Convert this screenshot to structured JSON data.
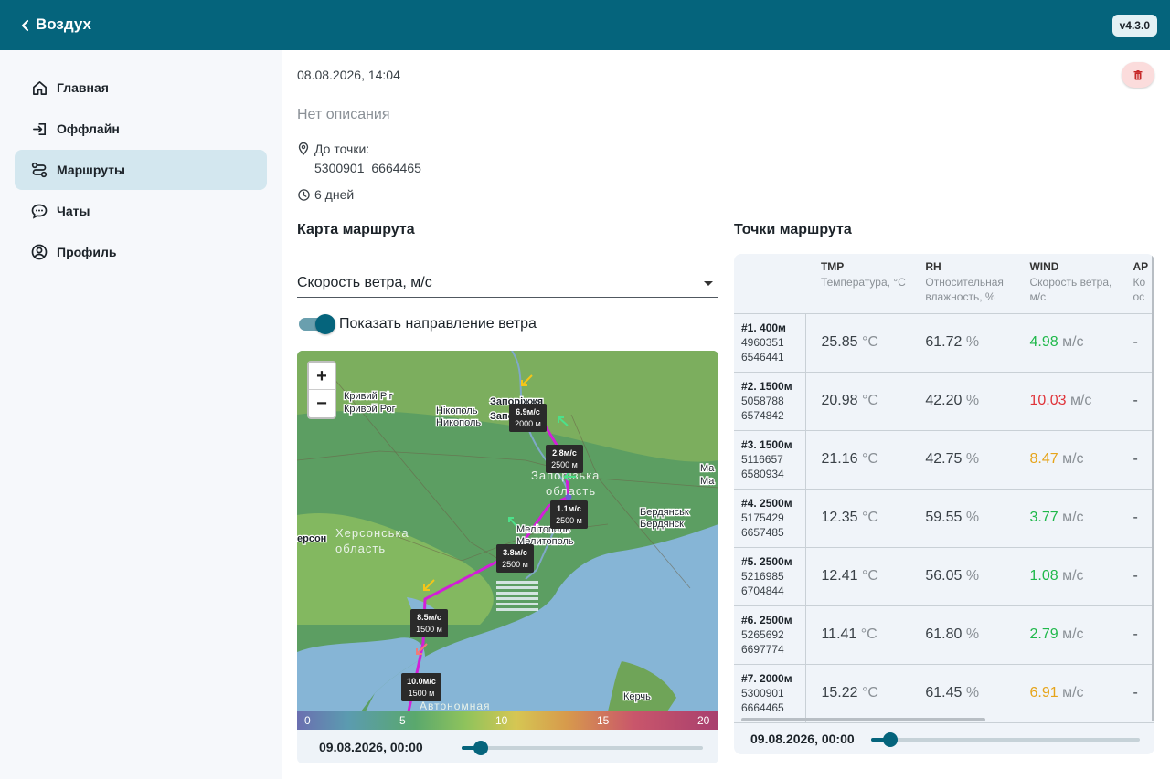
{
  "appbar": {
    "title": "Воздух",
    "version": "v4.3.0"
  },
  "sidebar": {
    "items": [
      {
        "label": "Главная",
        "icon": "home-icon"
      },
      {
        "label": "Оффлайн",
        "icon": "login-icon"
      },
      {
        "label": "Маршруты",
        "icon": "route-icon",
        "active": true
      },
      {
        "label": "Чаты",
        "icon": "chat-icon"
      },
      {
        "label": "Профиль",
        "icon": "account-icon"
      }
    ]
  },
  "route": {
    "date": "08.08.2026, 14:04",
    "description": "Нет описания",
    "to_point_label": "До точки:",
    "to_point_coords": "5300901 6664465",
    "duration": "6 дней"
  },
  "map_section": {
    "title": "Карта маршрута",
    "layer_select": "Скорость ветра, м/с",
    "toggle_label": "Показать направление ветра",
    "toggle_on": true,
    "zoom_in": "+",
    "zoom_out": "−",
    "place_labels": [
      "Кривий Ріг",
      "Кривой Рог",
      "Нікополь",
      "Никополь",
      "Запоріжжя",
      "Запорожье",
      "Запорізька",
      "область",
      "Бердянськ",
      "Бердянск",
      "Мелітополь",
      "Мелитополь",
      "Херсонська",
      "область",
      "ерсон",
      "Автономная",
      "Керчь",
      "Ма",
      "Ма"
    ],
    "markers": [
      {
        "speed": "6.9м/с",
        "alt": "2000 м"
      },
      {
        "speed": "2.8м/с",
        "alt": "2500 м"
      },
      {
        "speed": "1.1м/с",
        "alt": "2500 м"
      },
      {
        "speed": "3.8м/с",
        "alt": "2500 м"
      },
      {
        "speed": "8.5м/с",
        "alt": "1500 м"
      },
      {
        "speed": "10.0м/с",
        "alt": "1500 м"
      }
    ],
    "legend": [
      "0",
      "5",
      "10",
      "15",
      "20"
    ],
    "time": "09.08.2026, 00:00",
    "time_slider_fraction": 0.08
  },
  "points_section": {
    "title": "Точки маршрута",
    "columns": [
      {
        "code": "TMP",
        "desc": "Температура, °C"
      },
      {
        "code": "RH",
        "desc": "Относительная влажность, %"
      },
      {
        "code": "WIND",
        "desc": "Скорость ветра, м/с"
      },
      {
        "code": "AP",
        "desc": "Ко ос"
      }
    ],
    "rows": [
      {
        "title": "#1. 400м",
        "c1": "4960351",
        "c2": "6546441",
        "tmp": "25.85",
        "rh": "61.72",
        "wind": "4.98",
        "wind_color": "#1fb84a",
        "ap": "-"
      },
      {
        "title": "#2. 1500м",
        "c1": "5058788",
        "c2": "6574842",
        "tmp": "20.98",
        "rh": "42.20",
        "wind": "10.03",
        "wind_color": "#e0343a",
        "ap": "-"
      },
      {
        "title": "#3. 1500м",
        "c1": "5116657",
        "c2": "6580934",
        "tmp": "21.16",
        "rh": "42.75",
        "wind": "8.47",
        "wind_color": "#e6a41a",
        "ap": "-"
      },
      {
        "title": "#4. 2500м",
        "c1": "5175429",
        "c2": "6657485",
        "tmp": "12.35",
        "rh": "59.55",
        "wind": "3.77",
        "wind_color": "#1fb84a",
        "ap": "-"
      },
      {
        "title": "#5. 2500м",
        "c1": "5216985",
        "c2": "6704844",
        "tmp": "12.41",
        "rh": "56.05",
        "wind": "1.08",
        "wind_color": "#1fb84a",
        "ap": "-"
      },
      {
        "title": "#6. 2500м",
        "c1": "5265692",
        "c2": "6697774",
        "tmp": "11.41",
        "rh": "61.80",
        "wind": "2.79",
        "wind_color": "#1fb84a",
        "ap": "-"
      },
      {
        "title": "#7. 2000м",
        "c1": "5300901",
        "c2": "6664465",
        "tmp": "15.22",
        "rh": "61.45",
        "wind": "6.91",
        "wind_color": "#e6a41a",
        "ap": "-"
      }
    ],
    "units": {
      "tmp": "°C",
      "rh": "%",
      "wind": "м/с"
    },
    "time": "09.08.2026, 00:00",
    "time_slider_fraction": 0.07
  }
}
